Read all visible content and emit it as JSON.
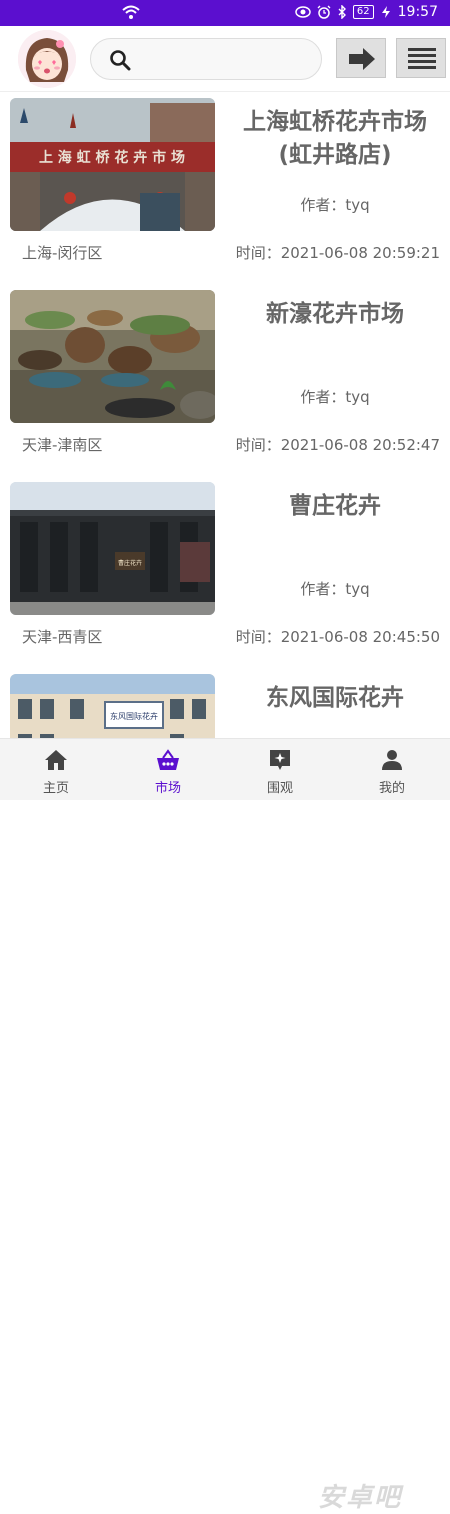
{
  "status_bar": {
    "battery": "62",
    "time": "19:57"
  },
  "header": {
    "search_placeholder": ""
  },
  "markets": [
    {
      "title": "上海虹桥花卉市场(虹井路店)",
      "author": "作者：tyq",
      "location": "上海-闵行区",
      "time": "时间：2021-06-08 20:59:21"
    },
    {
      "title": "新濠花卉市场",
      "author": "作者：tyq",
      "location": "天津-津南区",
      "time": "时间：2021-06-08 20:52:47"
    },
    {
      "title": "曹庄花卉",
      "author": "作者：tyq",
      "location": "天津-西青区",
      "time": "时间：2021-06-08 20:45:50"
    },
    {
      "title": "东风国际花卉",
      "author": "",
      "location": "",
      "time": ""
    }
  ],
  "photo_text": {
    "sign1": "上 海 虹 桥 花 卉 市 场",
    "sign3": "曹庄花卉",
    "sign4": "东风国际花卉"
  },
  "bottom_nav": {
    "items": [
      {
        "label": "主页",
        "icon": "home-icon"
      },
      {
        "label": "市场",
        "icon": "basket-icon"
      },
      {
        "label": "围观",
        "icon": "sparkle-chat-icon"
      },
      {
        "label": "我的",
        "icon": "person-icon"
      }
    ],
    "active_index": 1
  },
  "watermark": "安卓吧",
  "colors": {
    "status_bar": "#5b0fcf",
    "active_nav": "#5b0fcf",
    "text": "#666666"
  }
}
